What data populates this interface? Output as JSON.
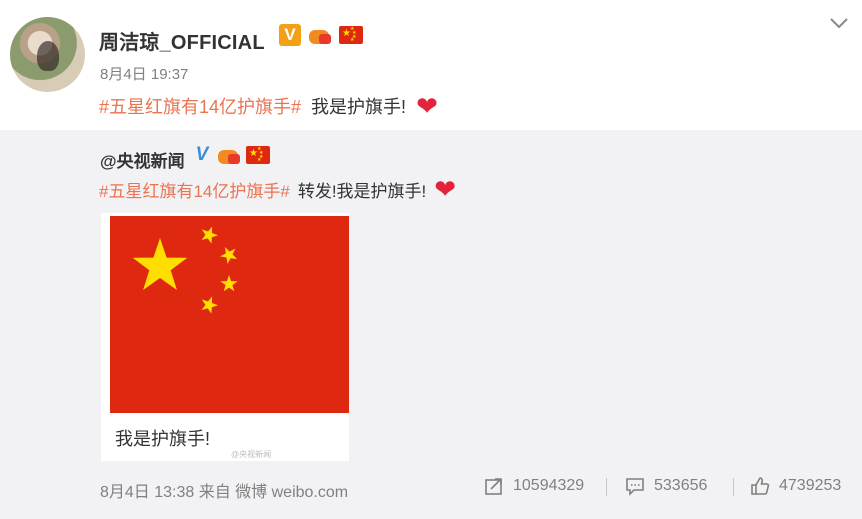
{
  "author": {
    "name": "周洁琼_OFFICIAL",
    "badge_v": "V",
    "time": "8月4日 19:37"
  },
  "post": {
    "hashtag": "#五星红旗有14亿护旗手#",
    "text": "我是护旗手!",
    "emoji": "❤"
  },
  "repost": {
    "user": "@央视新闻",
    "badge_v": "V",
    "hashtag": "#五星红旗有14亿护旗手#",
    "text": "转发!我是护旗手!",
    "emoji": "❤",
    "image_caption": "我是护旗手!",
    "watermark": "@央视新闻",
    "meta": "8月4日 13:38 来自 微博 weibo.com",
    "stats": {
      "forwards": "10594329",
      "comments": "533656",
      "likes": "4739253"
    }
  },
  "colors": {
    "hashtag": "#eb7350",
    "flag_red": "#de2910",
    "flag_yellow": "#ffde00",
    "repost_bg": "#f2f2f5"
  },
  "icons": [
    "chevron-down-icon",
    "verified-v-icon",
    "crown-icon",
    "china-flag-icon",
    "heart-icon",
    "forward-icon",
    "comment-icon",
    "like-icon"
  ]
}
